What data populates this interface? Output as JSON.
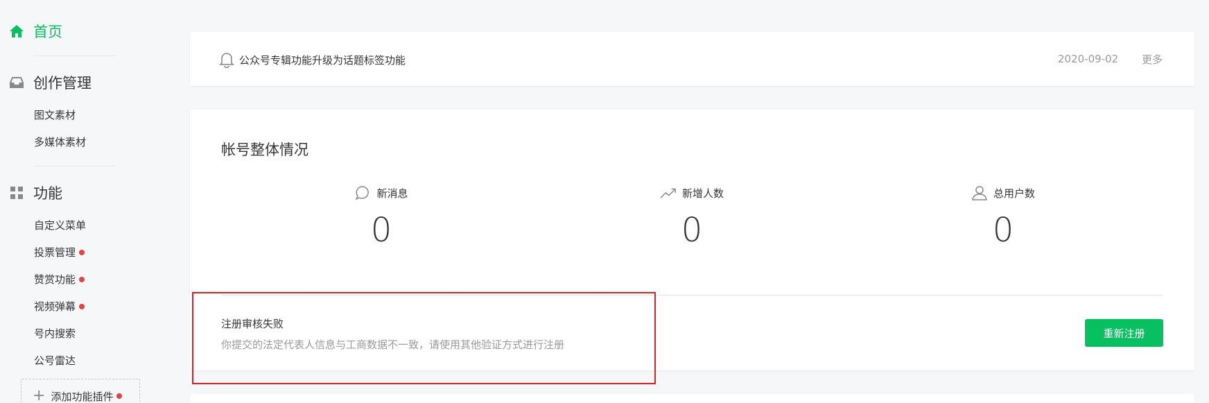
{
  "sidebar": {
    "home": "首页",
    "creation": {
      "label": "创作管理",
      "items": [
        "图文素材",
        "多媒体素材"
      ]
    },
    "features": {
      "label": "功能",
      "items": [
        {
          "label": "自定义菜单",
          "dot": false
        },
        {
          "label": "投票管理",
          "dot": true
        },
        {
          "label": "赞赏功能",
          "dot": true
        },
        {
          "label": "视频弹幕",
          "dot": true
        },
        {
          "label": "号内搜索",
          "dot": false
        },
        {
          "label": "公号雷达",
          "dot": false
        }
      ]
    },
    "add_plugin": "添加功能插件"
  },
  "notice": {
    "text": "公众号专辑功能升级为话题标签功能",
    "date": "2020-09-02",
    "more": "更多"
  },
  "overview": {
    "title": "帐号整体情况",
    "stats": [
      {
        "label": "新消息",
        "value": "0",
        "icon": "chat-bubble-icon"
      },
      {
        "label": "新增人数",
        "value": "0",
        "icon": "trend-up-icon"
      },
      {
        "label": "总用户数",
        "value": "0",
        "icon": "user-icon"
      }
    ],
    "registration": {
      "title": "注册审核失败",
      "desc": "你提交的法定代表人信息与工商数据不一致，请使用其他验证方式进行注册",
      "button": "重新注册"
    }
  },
  "colors": {
    "accent": "#07c160",
    "badge": "#e64340",
    "highlight_border": "#e02020"
  }
}
